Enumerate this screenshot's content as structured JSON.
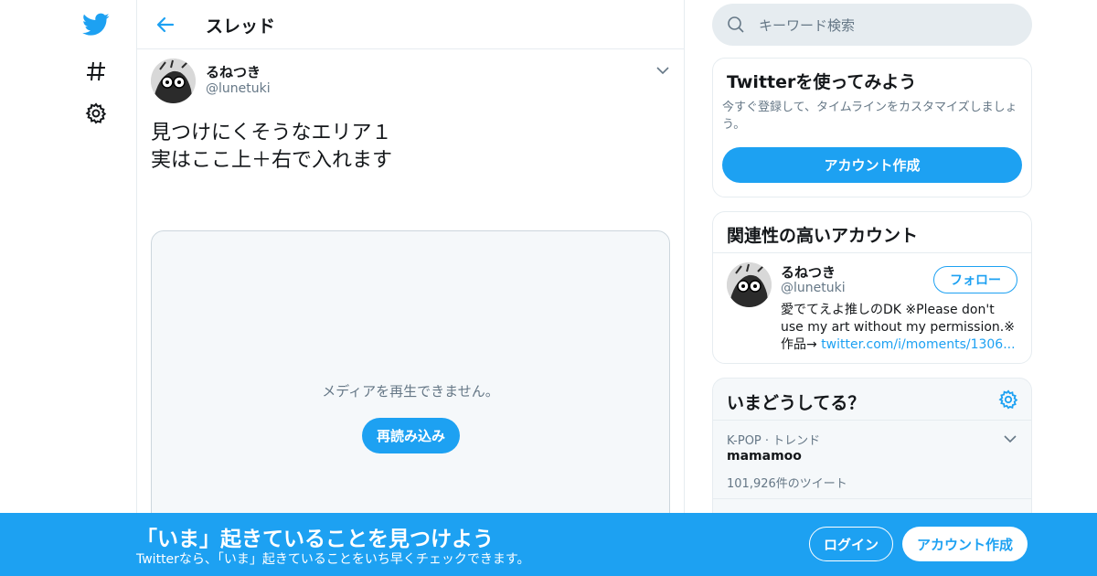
{
  "colors": {
    "accent": "#1da1f2",
    "muted": "#657786",
    "border": "#e6ecf0",
    "panel_bg": "#f5f8fa"
  },
  "nav": {
    "icons": [
      "twitter-bird-icon",
      "hashtag-icon",
      "gear-icon"
    ]
  },
  "header": {
    "title": "スレッド",
    "back_icon": "arrow-left-icon"
  },
  "tweet": {
    "name": "るねつき",
    "handle": "@lunetuki",
    "text": "見つけにくそうなエリア１\n実はここ上＋右で入れます",
    "media": {
      "message": "メディアを再生できません。",
      "reload_label": "再読み込み"
    }
  },
  "search": {
    "placeholder": "キーワード検索"
  },
  "signup_card": {
    "title": "Twitterを使ってみよう",
    "desc": "今すぐ登録して、タイムラインをカスタマイズしましょう。",
    "button": "アカウント作成"
  },
  "related_card": {
    "title": "関連性の高いアカウント",
    "name": "るねつき",
    "handle": "@lunetuki",
    "follow_label": "フォロー",
    "bio": "愛でてえよ推しのDK ※Please don't use my art without my permission.※作品→ ",
    "bio_link": "twitter.com/i/moments/1306..."
  },
  "trends_card": {
    "title": "いまどうしてる？",
    "items": [
      {
        "category": "K-POP · トレンド",
        "name": "mamamoo",
        "count": "101,926件のツイート"
      }
    ]
  },
  "bottom_bar": {
    "title": "「いま」起きていることを見つけよう",
    "subtitle": "Twitterなら、「いま」起きていることをいち早くチェックできます。",
    "login": "ログイン",
    "signup": "アカウント作成"
  }
}
